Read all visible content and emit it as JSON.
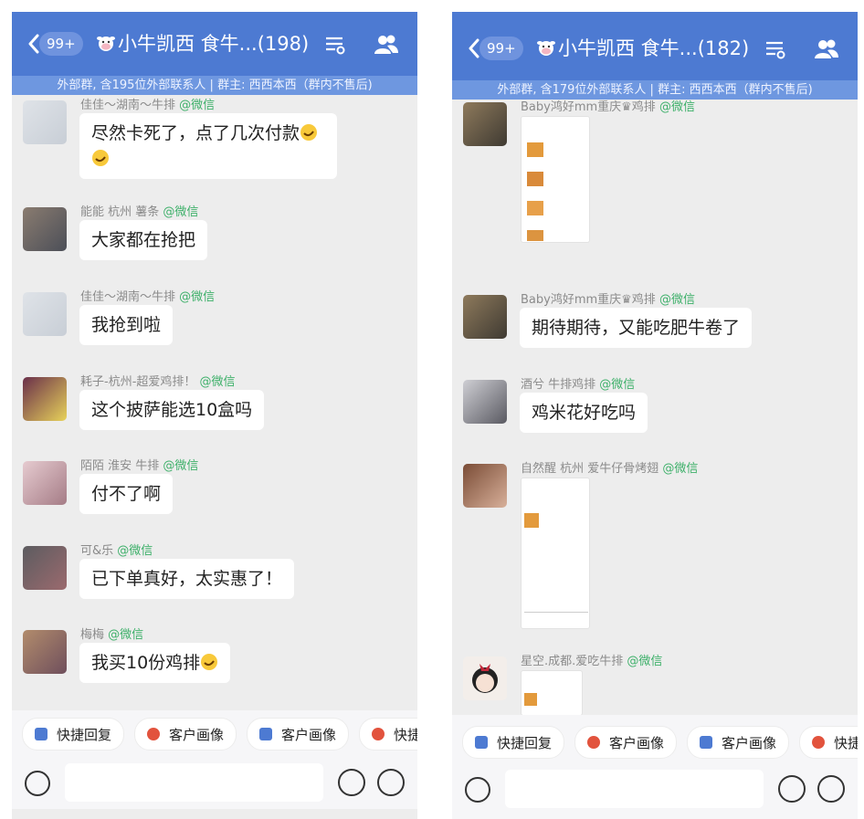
{
  "left": {
    "badge": "99+",
    "title": "小牛凯西 食牛...(198)",
    "subheader": "外部群, 含195位外部联系人 | 群主: 西西本西（群内不售后)",
    "source_tag": "@微信",
    "messages": [
      {
        "sender": "佳佳～湖南～牛排",
        "line1": "尽然卡死了，点了几次付款"
      },
      {
        "sender": "能能 杭州 薯条",
        "text": "大家都在抢把"
      },
      {
        "sender": "佳佳～湖南～牛排",
        "text": "我抢到啦"
      },
      {
        "sender": "耗子-杭州-超爱鸡排！",
        "text": "这个披萨能选10盒吗"
      },
      {
        "sender": "陌陌  淮安   牛排",
        "text": "付不了啊"
      },
      {
        "sender": "可&乐",
        "text": "已下单真好，太实惠了！"
      },
      {
        "sender": "梅梅",
        "text": "我买10份鸡排"
      }
    ],
    "chips": [
      "快捷回复",
      "客户画像",
      "客户画像",
      "快捷回复"
    ]
  },
  "right": {
    "badge": "99+",
    "title": "小牛凯西 食牛...(182)",
    "subheader": "外部群, 含179位外部联系人 | 群主: 西西本西（群内不售后)",
    "source_tag": "@微信",
    "messages": [
      {
        "sender": "Baby鸿好mm重庆♛鸡排",
        "type": "image"
      },
      {
        "sender": "Baby鸿好mm重庆♛鸡排",
        "text": "期待期待，又能吃肥牛卷了"
      },
      {
        "sender": "酒兮 牛排鸡排",
        "text": "鸡米花好吃吗"
      },
      {
        "sender": "自然醒 杭州 爱牛仔骨烤翅",
        "type": "image"
      },
      {
        "sender": "星空.成都.爱吃牛排",
        "type": "image"
      }
    ],
    "chips": [
      "快捷回复",
      "客户画像",
      "客户画像",
      "快捷回复"
    ]
  },
  "colors": {
    "header": "#4d7ad2",
    "subheader": "#6e97e0",
    "source_tag": "#3eb06a",
    "chat_bg": "#ededed"
  }
}
